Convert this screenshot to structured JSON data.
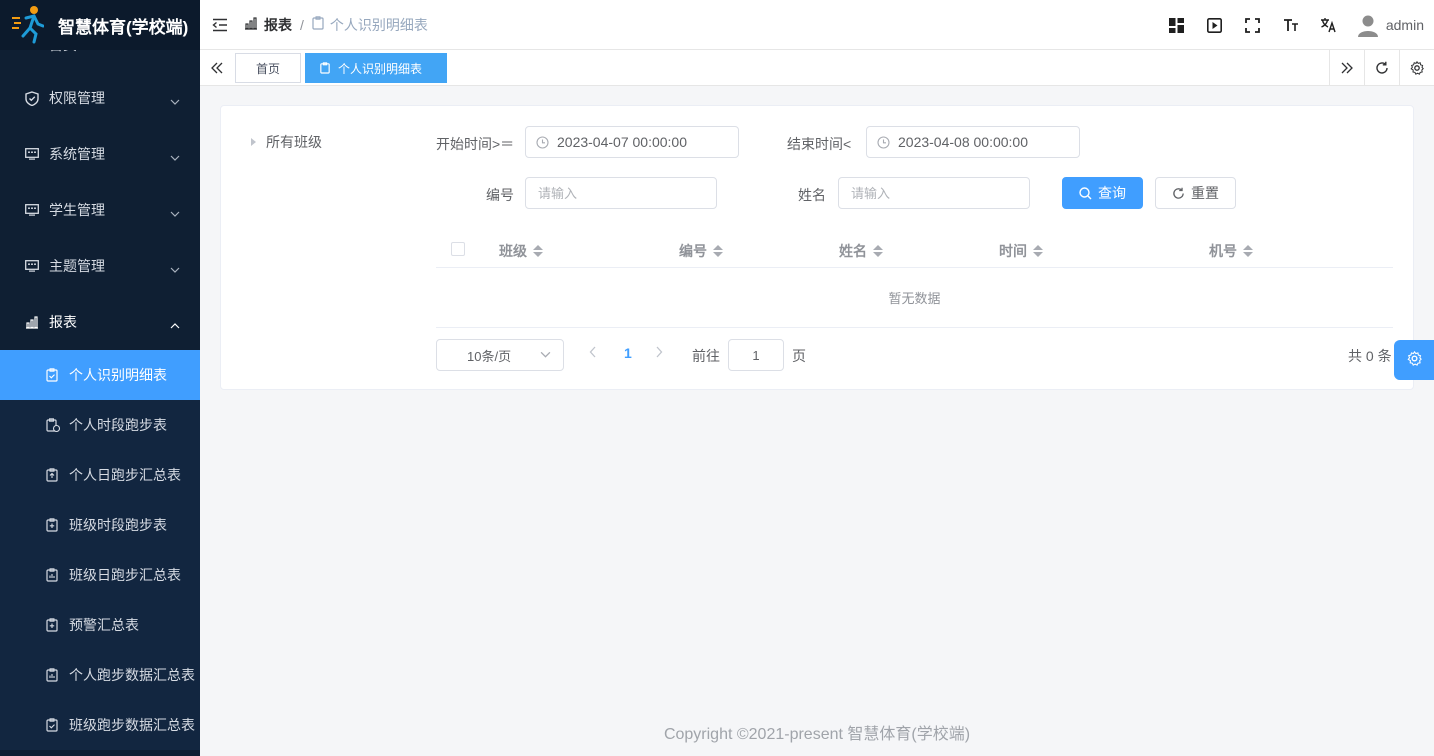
{
  "app": {
    "title": "智慧体育(学校端)",
    "user": "admin"
  },
  "sidebar": {
    "partial_item": "首页",
    "groups": [
      {
        "label": "权限管理",
        "icon": "shield-icon"
      },
      {
        "label": "系统管理",
        "icon": "monitor-icon"
      },
      {
        "label": "学生管理",
        "icon": "monitor-icon"
      },
      {
        "label": "主题管理",
        "icon": "monitor-icon"
      },
      {
        "label": "报表",
        "icon": "bar-chart-icon"
      }
    ],
    "submenu": [
      {
        "label": "个人识别明细表",
        "active": true
      },
      {
        "label": "个人时段跑步表"
      },
      {
        "label": "个人日跑步汇总表"
      },
      {
        "label": "班级时段跑步表"
      },
      {
        "label": "班级日跑步汇总表"
      },
      {
        "label": "预警汇总表"
      },
      {
        "label": "个人跑步数据汇总表"
      },
      {
        "label": "班级跑步数据汇总表"
      }
    ]
  },
  "breadcrumb": {
    "parent": "报表",
    "separator": "/",
    "current": "个人识别明细表"
  },
  "tabs": {
    "home": "首页",
    "current": "个人识别明细表"
  },
  "filters": {
    "tree_root": "所有班级",
    "start_label": "开始时间>＝",
    "start_value": "2023-04-07 00:00:00",
    "end_label": "结束时间<",
    "end_value": "2023-04-08 00:00:00",
    "code_label": "编号",
    "code_placeholder": "请输入",
    "name_label": "姓名",
    "name_placeholder": "请输入",
    "search_label": "查询",
    "reset_label": "重置"
  },
  "table": {
    "columns": [
      "班级",
      "编号",
      "姓名",
      "时间",
      "机号"
    ],
    "empty_text": "暂无数据"
  },
  "pagination": {
    "page_size": "10条/页",
    "current_page": "1",
    "goto_prefix": "前往",
    "goto_value": "1",
    "goto_suffix": "页",
    "total": "共 0 条"
  },
  "footer": "Copyright ©2021-present 智慧体育(学校端)",
  "colors": {
    "sidebar_bg": "#0f1f33",
    "accent": "#409eff"
  }
}
